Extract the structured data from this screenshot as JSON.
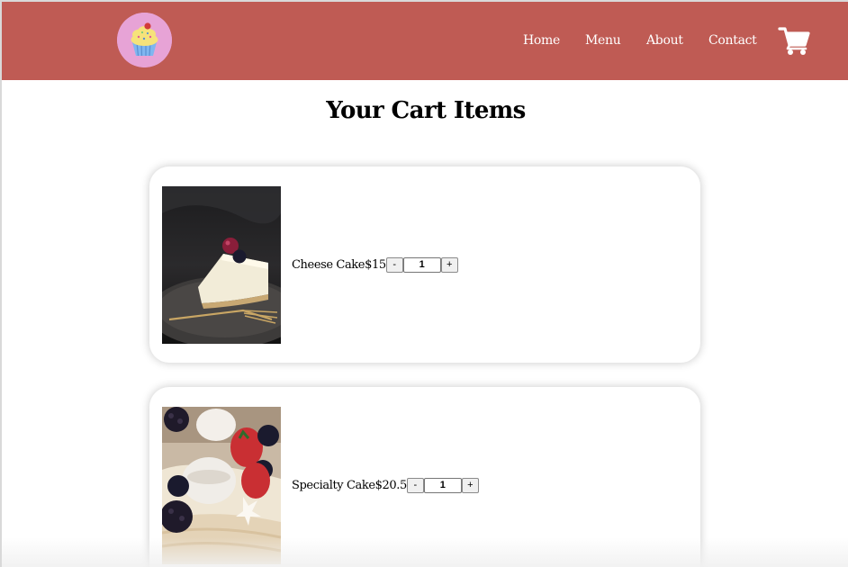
{
  "header": {
    "logo_icon": "cupcake-logo-icon",
    "nav": [
      "Home",
      "Menu",
      "About",
      "Contact"
    ],
    "cart_icon": "shopping-cart-icon",
    "colors": {
      "header_bg": "#bf5b54",
      "logo_bg": "#e7a3d6",
      "nav_text": "#ffffff"
    }
  },
  "main": {
    "title": "Your Cart Items",
    "items": [
      {
        "name": "Cheese Cake",
        "price": "$15",
        "quantity": "1",
        "decrement": "-",
        "increment": "+",
        "image": "cheesecake-photo"
      },
      {
        "name": "Specialty Cake",
        "price": "$20.5",
        "quantity": "1",
        "decrement": "-",
        "increment": "+",
        "image": "specialty-cake-photo"
      }
    ]
  }
}
